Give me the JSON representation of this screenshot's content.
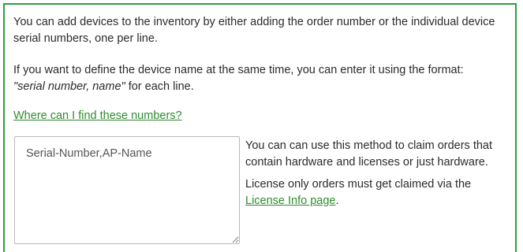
{
  "instructions": {
    "paragraph1": "You can add devices to the inventory by either adding the order number or the individual device serial numbers, one per line.",
    "paragraph2_prefix": "If you want to define the device name at the same time, you can enter it using the format:",
    "paragraph2_format": "\"serial number, name\"",
    "paragraph2_suffix": " for each line.",
    "help_link": "Where can I find these numbers?"
  },
  "input": {
    "placeholder": "Serial-Number,AP-Name",
    "value": ""
  },
  "side_notes": {
    "note1": "You can can use this method to claim orders that contain hardware and licenses or just hardware.",
    "note2_prefix": "License only orders must get claimed via the ",
    "note2_link": "License Info page",
    "note2_suffix": "."
  },
  "colors": {
    "accent": "#2e9e3c",
    "link": "#2e8b2e",
    "text": "#2b2b2b"
  }
}
